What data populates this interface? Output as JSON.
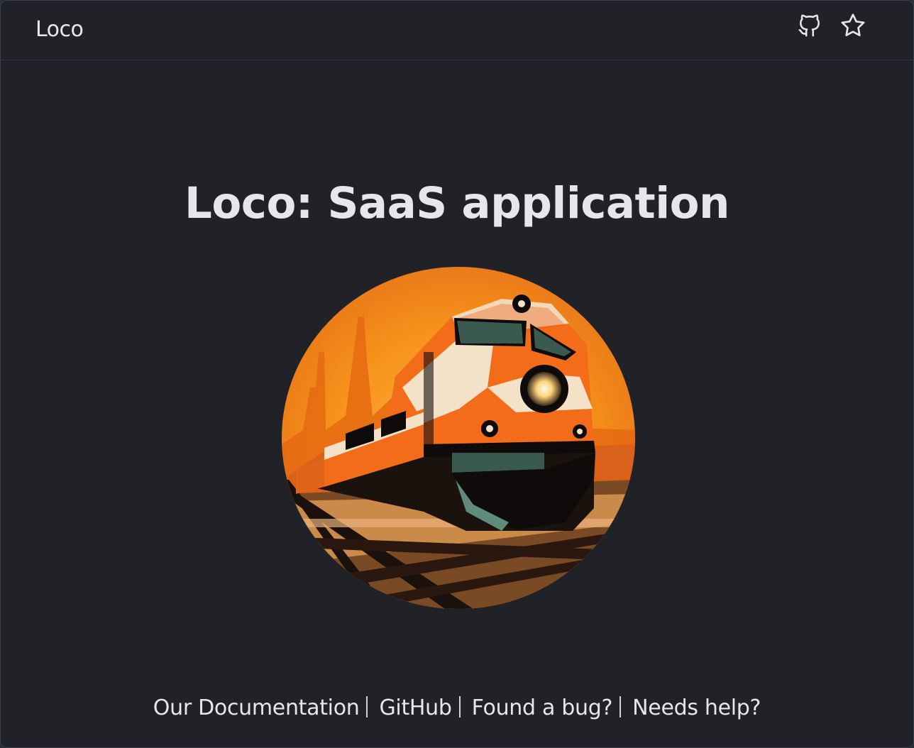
{
  "header": {
    "brand": "Loco",
    "github_icon": "github-icon",
    "star_icon": "star-icon"
  },
  "main": {
    "title": "Loco: SaaS application",
    "hero_image": "locomotive-train-illustration"
  },
  "footer": {
    "links": [
      {
        "label": "Our Documentation"
      },
      {
        "label": "GitHub"
      },
      {
        "label": "Found a bug?"
      },
      {
        "label": "Needs help?"
      }
    ]
  },
  "colors": {
    "background": "#202227",
    "text": "#e6e7e9",
    "accent_orange": "#f7931a"
  }
}
